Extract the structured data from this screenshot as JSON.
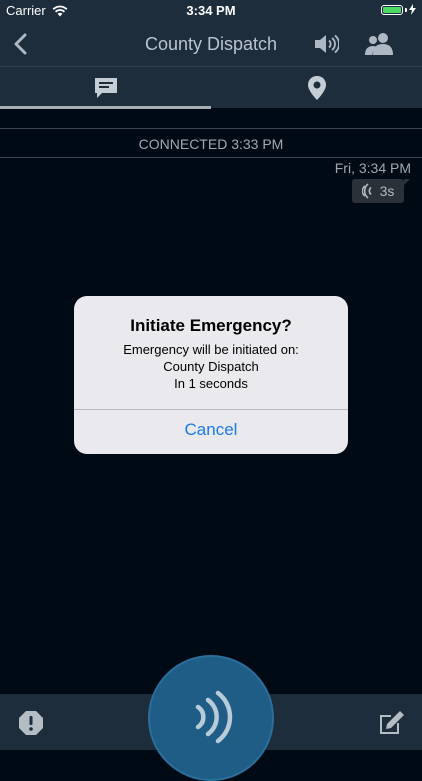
{
  "status_bar": {
    "carrier": "Carrier",
    "time": "3:34 PM"
  },
  "nav": {
    "title": "County Dispatch"
  },
  "tabs": [
    {
      "name": "messages",
      "icon": "chat-icon",
      "selected": true
    },
    {
      "name": "location",
      "icon": "location-pin-icon",
      "selected": false
    }
  ],
  "feed": {
    "connected_label": "CONNECTED 3:33 PM",
    "message_timestamp": "Fri, 3:34 PM",
    "voice_duration": "3s"
  },
  "alert": {
    "title": "Initiate Emergency?",
    "line1": "Emergency will be initiated on:",
    "line2": "County Dispatch",
    "line3": "In 1 seconds",
    "cancel_label": "Cancel"
  },
  "colors": {
    "background": "#000a14",
    "bar": "#1e2d3c",
    "ptt": "#1f5d86",
    "alert_action": "#1a7bf0",
    "battery": "#4cd964"
  }
}
